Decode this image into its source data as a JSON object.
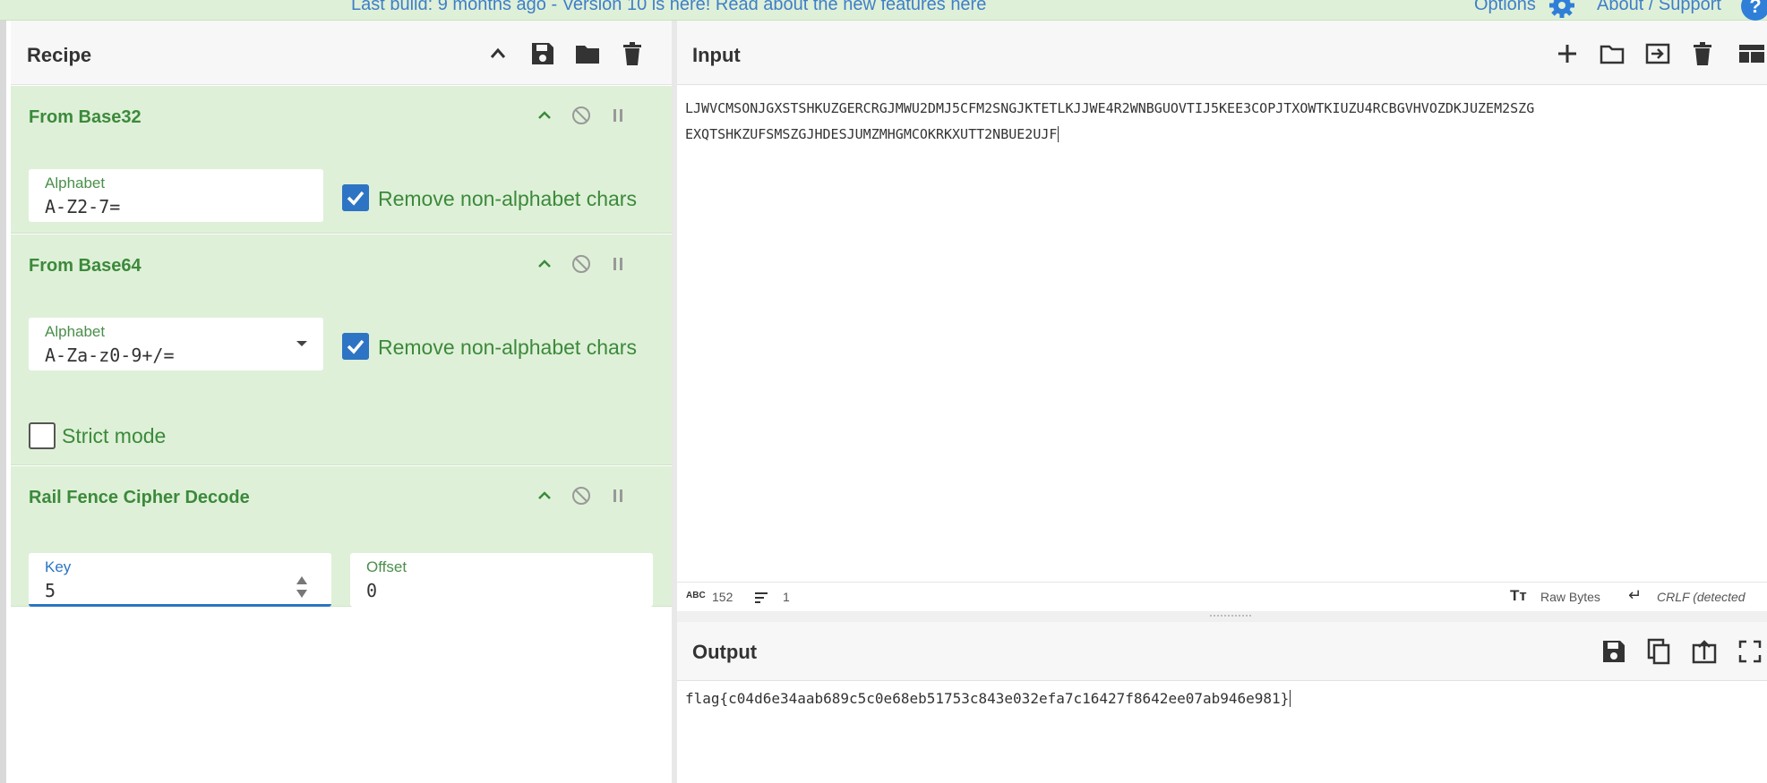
{
  "banner": {
    "text": "Last build: 9 months ago - Version 10 is here! Read about the new features",
    "link": "here",
    "options": "Options",
    "about": "About / Support",
    "help": "?"
  },
  "recipe": {
    "title": "Recipe",
    "operations": [
      {
        "title": "From Base32",
        "alphabet_label": "Alphabet",
        "alphabet_value": "A-Z2-7=",
        "remove_label": "Remove non-alphabet chars",
        "remove_checked": true
      },
      {
        "title": "From Base64",
        "alphabet_label": "Alphabet",
        "alphabet_value": "A-Za-z0-9+/=",
        "remove_label": "Remove non-alphabet chars",
        "remove_checked": true,
        "strict_label": "Strict mode",
        "strict_checked": false
      },
      {
        "title": "Rail Fence Cipher Decode",
        "key_label": "Key",
        "key_value": "5",
        "offset_label": "Offset",
        "offset_value": "0"
      }
    ]
  },
  "input": {
    "title": "Input",
    "line1": "LJWVCMSONJGXSTSHKUZGERCRGJMWU2DMJ5CFM2SNGJKTETLKJJWE4R2WNBGUOVTIJ5KEE3COPJTXOWTKIUZU4RCBGVHVOZDKJUZEM2SZG",
    "line2": "EXQTSHKZUFSMSZGJHDESJUMZMHGMCOKRKXUTT2NBUE2UJF",
    "char_count": "152",
    "line_count": "1",
    "encoding": "Raw Bytes",
    "eol": "CRLF (detected"
  },
  "output": {
    "title": "Output",
    "text": "flag{c04d6e34aab689c5c0e68eb51753c843e032efa7c16427f8642ee07ab946e981}"
  },
  "colors": {
    "op_bg": "#dff0d8",
    "op_title": "#3b8a3b",
    "accent": "#2d74c4",
    "link": "#3f7fc8"
  }
}
